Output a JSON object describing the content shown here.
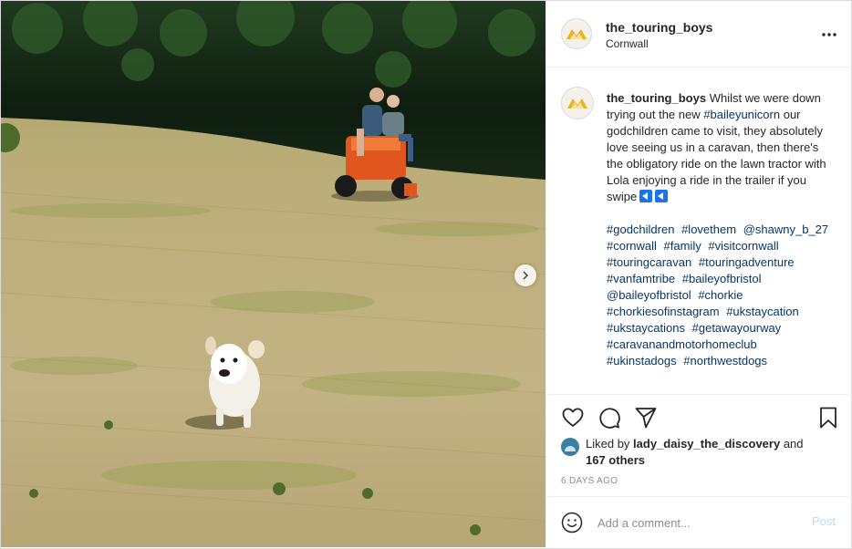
{
  "post": {
    "username": "the_touring_boys",
    "location": "Cornwall",
    "caption": {
      "username": "the_touring_boys",
      "text_before_tag": "Whilst we were down trying out the new",
      "tag1": "#baileyunicorn",
      "text_after_tag": "our godchildren came to visit, they absolutely love seeing us in a caravan, then there's the obligatory ride on the lawn tractor with Lola enjoying a ride in the trailer if you swipe",
      "hashtags": [
        "#godchildren",
        "#lovethem",
        "@shawny_b_27",
        "#cornwall",
        "#family",
        "#visitcornwall",
        "#touringcaravan",
        "#touringadventure",
        "#vanfamtribe",
        "#baileyofbristol",
        "@baileyofbristol",
        "#chorkie",
        "#chorkiesofinstagram",
        "#ukstaycation",
        "#ukstaycations",
        "#getawayourway",
        "#caravanandmotorhomeclub",
        "#ukinstadogs",
        "#northwestdogs"
      ]
    },
    "liked_by_prefix": "Liked by",
    "liked_by_user": "lady_daisy_the_discovery",
    "liked_by_and": "and",
    "liked_by_others": "167 others",
    "date": "6 DAYS AGO",
    "comment_placeholder": "Add a comment...",
    "post_label": "Post"
  },
  "icons": {
    "more": "more-options-icon",
    "like": "heart-icon",
    "comment": "comment-icon",
    "share": "share-icon",
    "save": "bookmark-icon",
    "emoji": "smiley-icon",
    "next": "chevron-right-icon"
  },
  "colors": {
    "link": "#00376b",
    "post_button_disabled": "#b2dffc",
    "muted": "#8e8e8e",
    "border": "#efefef"
  }
}
